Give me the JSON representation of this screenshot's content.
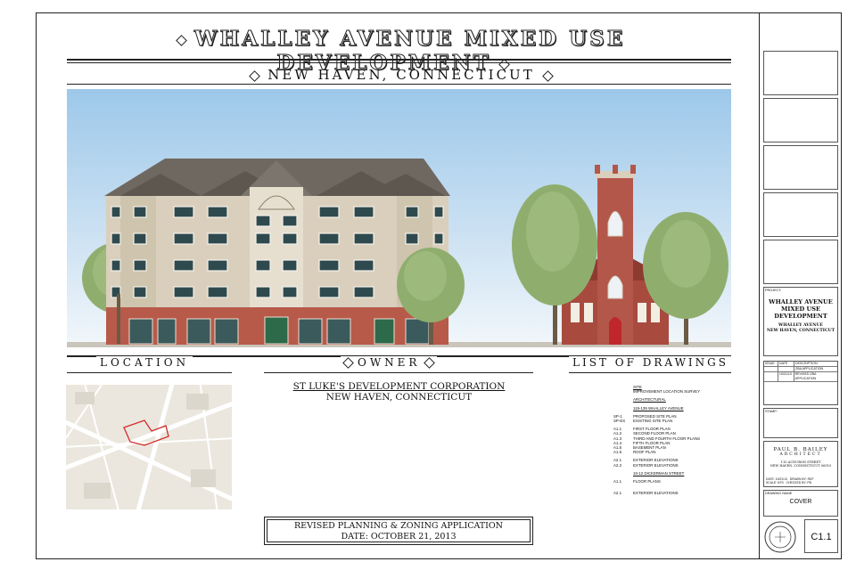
{
  "header": {
    "title": "WHALLEY AVENUE MIXED USE DEVELOPMENT",
    "subtitle": "NEW HAVEN, CONNECTICUT"
  },
  "sections": {
    "location": "LOCATION",
    "owner": "OWNER",
    "drawings": "LIST OF DRAWINGS"
  },
  "owner": {
    "name": "ST LUKE'S DEVELOPMENT CORPORATION",
    "city": "NEW HAVEN, CONNECTICUT"
  },
  "revision": {
    "line1": "REVISED PLANNING & ZONING APPLICATION",
    "line2": "DATE: OCTOBER 21, 2013"
  },
  "drawings": [
    {
      "type": "head",
      "label": "SITE"
    },
    {
      "type": "item",
      "code": "",
      "label": "IMPROVEMENT LOCATION SURVEY"
    },
    {
      "type": "gap"
    },
    {
      "type": "head",
      "label": "ARCHITECTURAL"
    },
    {
      "type": "gap"
    },
    {
      "type": "head",
      "label": "119-139 WHALLEY AVENUE"
    },
    {
      "type": "gap"
    },
    {
      "type": "item",
      "code": "SP-1",
      "label": "PROPOSED SITE PLAN"
    },
    {
      "type": "item",
      "code": "SP-EX",
      "label": "EXISTING SITE PLAN"
    },
    {
      "type": "gap"
    },
    {
      "type": "item",
      "code": "A1.1",
      "label": "FIRST FLOOR PLAN"
    },
    {
      "type": "item",
      "code": "A1.2",
      "label": "SECOND FLOOR PLAN"
    },
    {
      "type": "item",
      "code": "A1.3",
      "label": "THIRD AND FOURTH FLOOR PLANS"
    },
    {
      "type": "item",
      "code": "A1.4",
      "label": "FIFTH FLOOR PLAN"
    },
    {
      "type": "item",
      "code": "A1.5",
      "label": "BASEMENT PLAN"
    },
    {
      "type": "item",
      "code": "A1.6",
      "label": "ROOF PLAN"
    },
    {
      "type": "gap"
    },
    {
      "type": "item",
      "code": "A2.1",
      "label": "EXTERIOR ELEVATIONS"
    },
    {
      "type": "item",
      "code": "A2.2",
      "label": "EXTERIOR ELEVATIONS"
    },
    {
      "type": "gap"
    },
    {
      "type": "head",
      "label": "10-12 DICKERMAN STREET"
    },
    {
      "type": "gap"
    },
    {
      "type": "item",
      "code": "A1.1",
      "label": "FLOOR PLANS"
    },
    {
      "type": "gap"
    },
    {
      "type": "gap"
    },
    {
      "type": "item",
      "code": "A2.1",
      "label": "EXTERIOR ELEVATIONS"
    }
  ],
  "titleblock": {
    "project_label": "PROJECT:",
    "project_line1": "WHALLEY AVENUE",
    "project_line2": "MIXED USE",
    "project_line3": "DEVELOPMENT",
    "project_addr1": "WHALLEY AVENUE",
    "project_addr2": "NEW HAVEN, CONNECTICUT",
    "issue_head": [
      "ISSUE",
      "DATE",
      "DESCRIPTION"
    ],
    "issue_rows": [
      [
        "",
        "",
        "ZBA APPLICATION"
      ],
      [
        "",
        "10/21/13",
        "REVISED ZBA APPLICATION"
      ]
    ],
    "stamp_label": "STAMP:",
    "architect_name": "PAUL B. BAILEY",
    "architect_sub": "ARCHITECT",
    "architect_addr": "110 AUDUBON STREET",
    "architect_city": "NEW HAVEN, CONNECTICUT 06510",
    "drawing_name_label": "DRAWING NAME",
    "drawing_name": "COVER",
    "date_label": "DATE:",
    "date_value": "10/21/13",
    "scale_label": "SCALE:",
    "scale_value": "NTS",
    "drawn_label": "DRAWN BY:",
    "drawn_value": "RDF",
    "checked_label": "CHECKED BY:",
    "checked_value": "PB",
    "sheet_number": "C1.1"
  }
}
